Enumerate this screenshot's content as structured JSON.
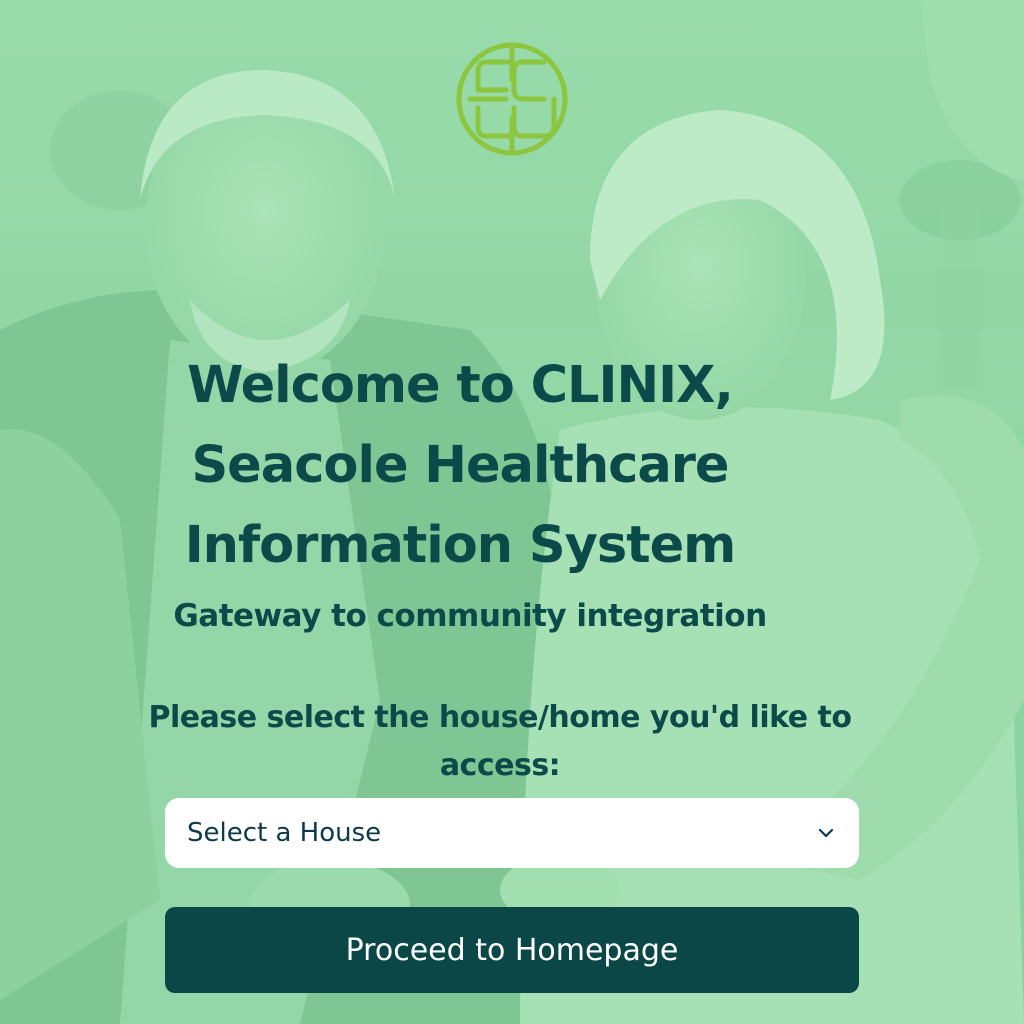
{
  "brand": {
    "logo_icon": "seacole-es-logo-icon",
    "logo_color": "#8cc63f"
  },
  "welcome": {
    "title_line1": "Welcome to CLINIX,",
    "title_line2": "Seacole Healthcare",
    "title_line3": "Information System",
    "subtitle": "Gateway to community integration"
  },
  "house_selector": {
    "prompt_line1": "Please select the house/home you'd like to",
    "prompt_line2": "access:",
    "selected_value": "Select a House",
    "icon": "chevron-down-icon"
  },
  "actions": {
    "proceed_label": "Proceed to Homepage"
  },
  "colors": {
    "text": "#0c4a4a",
    "button_bg": "#0b4747",
    "overlay": "#96deaa"
  }
}
